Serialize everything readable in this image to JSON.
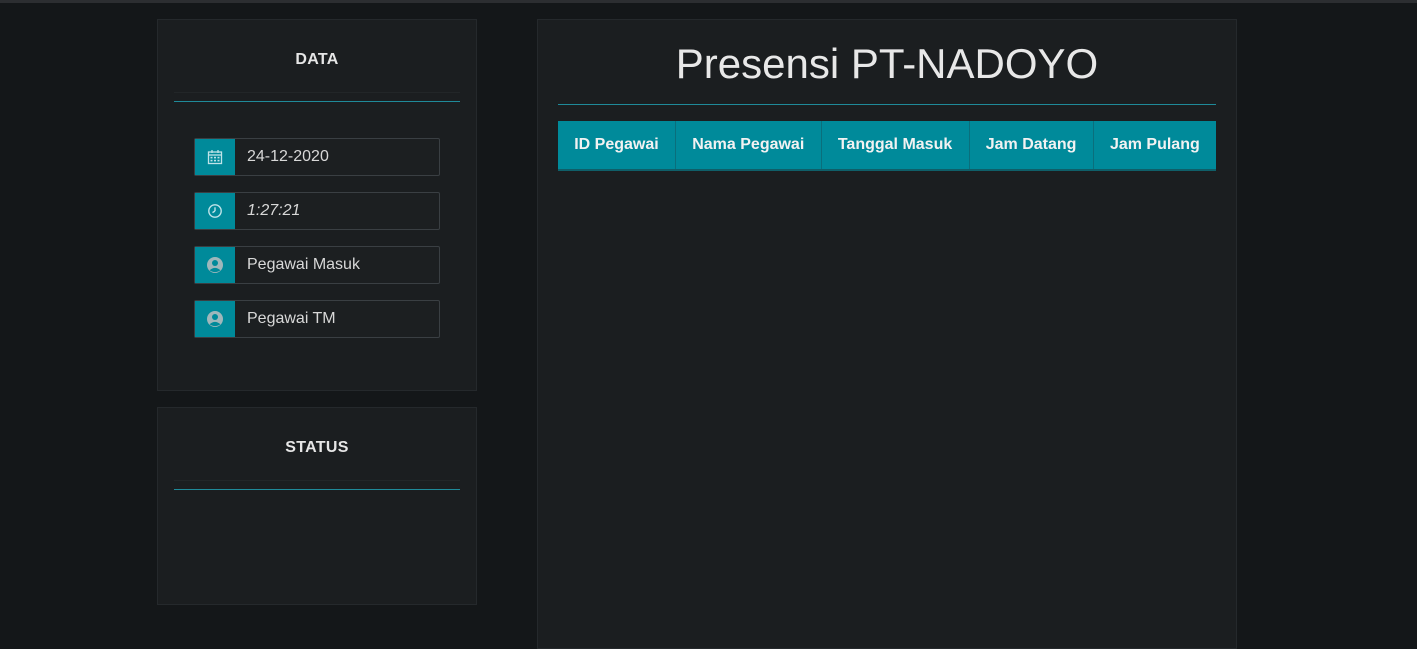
{
  "data_panel": {
    "title": "DATA",
    "fields": [
      {
        "icon": "calendar-icon",
        "value": "24-12-2020"
      },
      {
        "icon": "clock-icon",
        "value": "1:27:21"
      },
      {
        "icon": "user-icon",
        "value": "Pegawai Masuk"
      },
      {
        "icon": "user-icon",
        "value": "Pegawai TM"
      }
    ]
  },
  "status_panel": {
    "title": "STATUS"
  },
  "main": {
    "title": "Presensi PT-NADOYO",
    "table": {
      "columns": [
        "ID Pegawai",
        "Nama Pegawai",
        "Tanggal Masuk",
        "Jam Datang",
        "Jam Pulang"
      ],
      "rows": []
    }
  },
  "colors": {
    "accent": "#008a9a",
    "background": "#141719",
    "panel": "#1b1e20"
  }
}
